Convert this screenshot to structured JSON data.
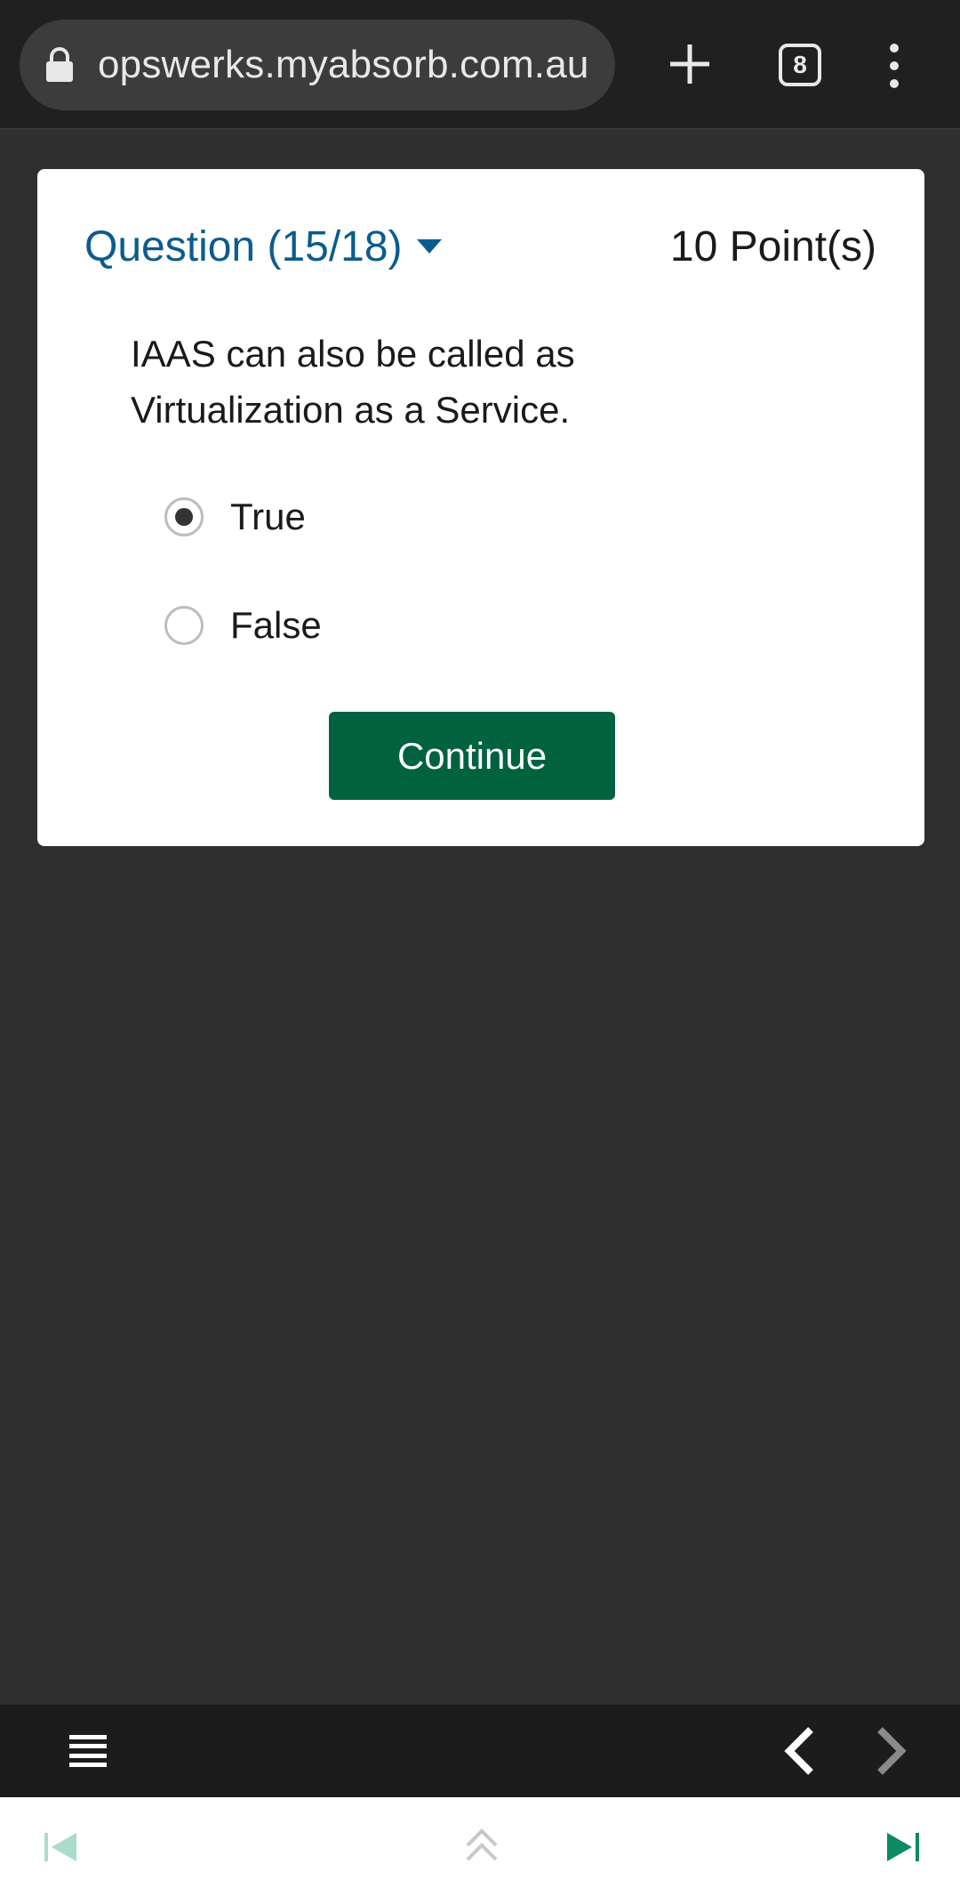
{
  "browser": {
    "url": "opswerks.myabsorb.com.au",
    "tab_count": "8",
    "icons": [
      "lock-icon",
      "plus-icon",
      "tabs-icon",
      "more-vert-icon"
    ]
  },
  "question": {
    "title": "Question (15/18)",
    "points": "10 Point(s)",
    "text": "IAAS can also be called as Virtualization as a Service.",
    "options": [
      {
        "label": "True",
        "selected": true
      },
      {
        "label": "False",
        "selected": false
      }
    ],
    "continue_label": "Continue"
  },
  "player": {
    "icons": [
      "menu-icon",
      "chevron-left-icon",
      "chevron-right-icon",
      "skip-first-icon",
      "double-chevron-up-icon",
      "skip-last-icon"
    ],
    "colors": {
      "accent": "#016240",
      "link": "#0b5c8e",
      "footer_accent": "#0c8a63"
    }
  }
}
